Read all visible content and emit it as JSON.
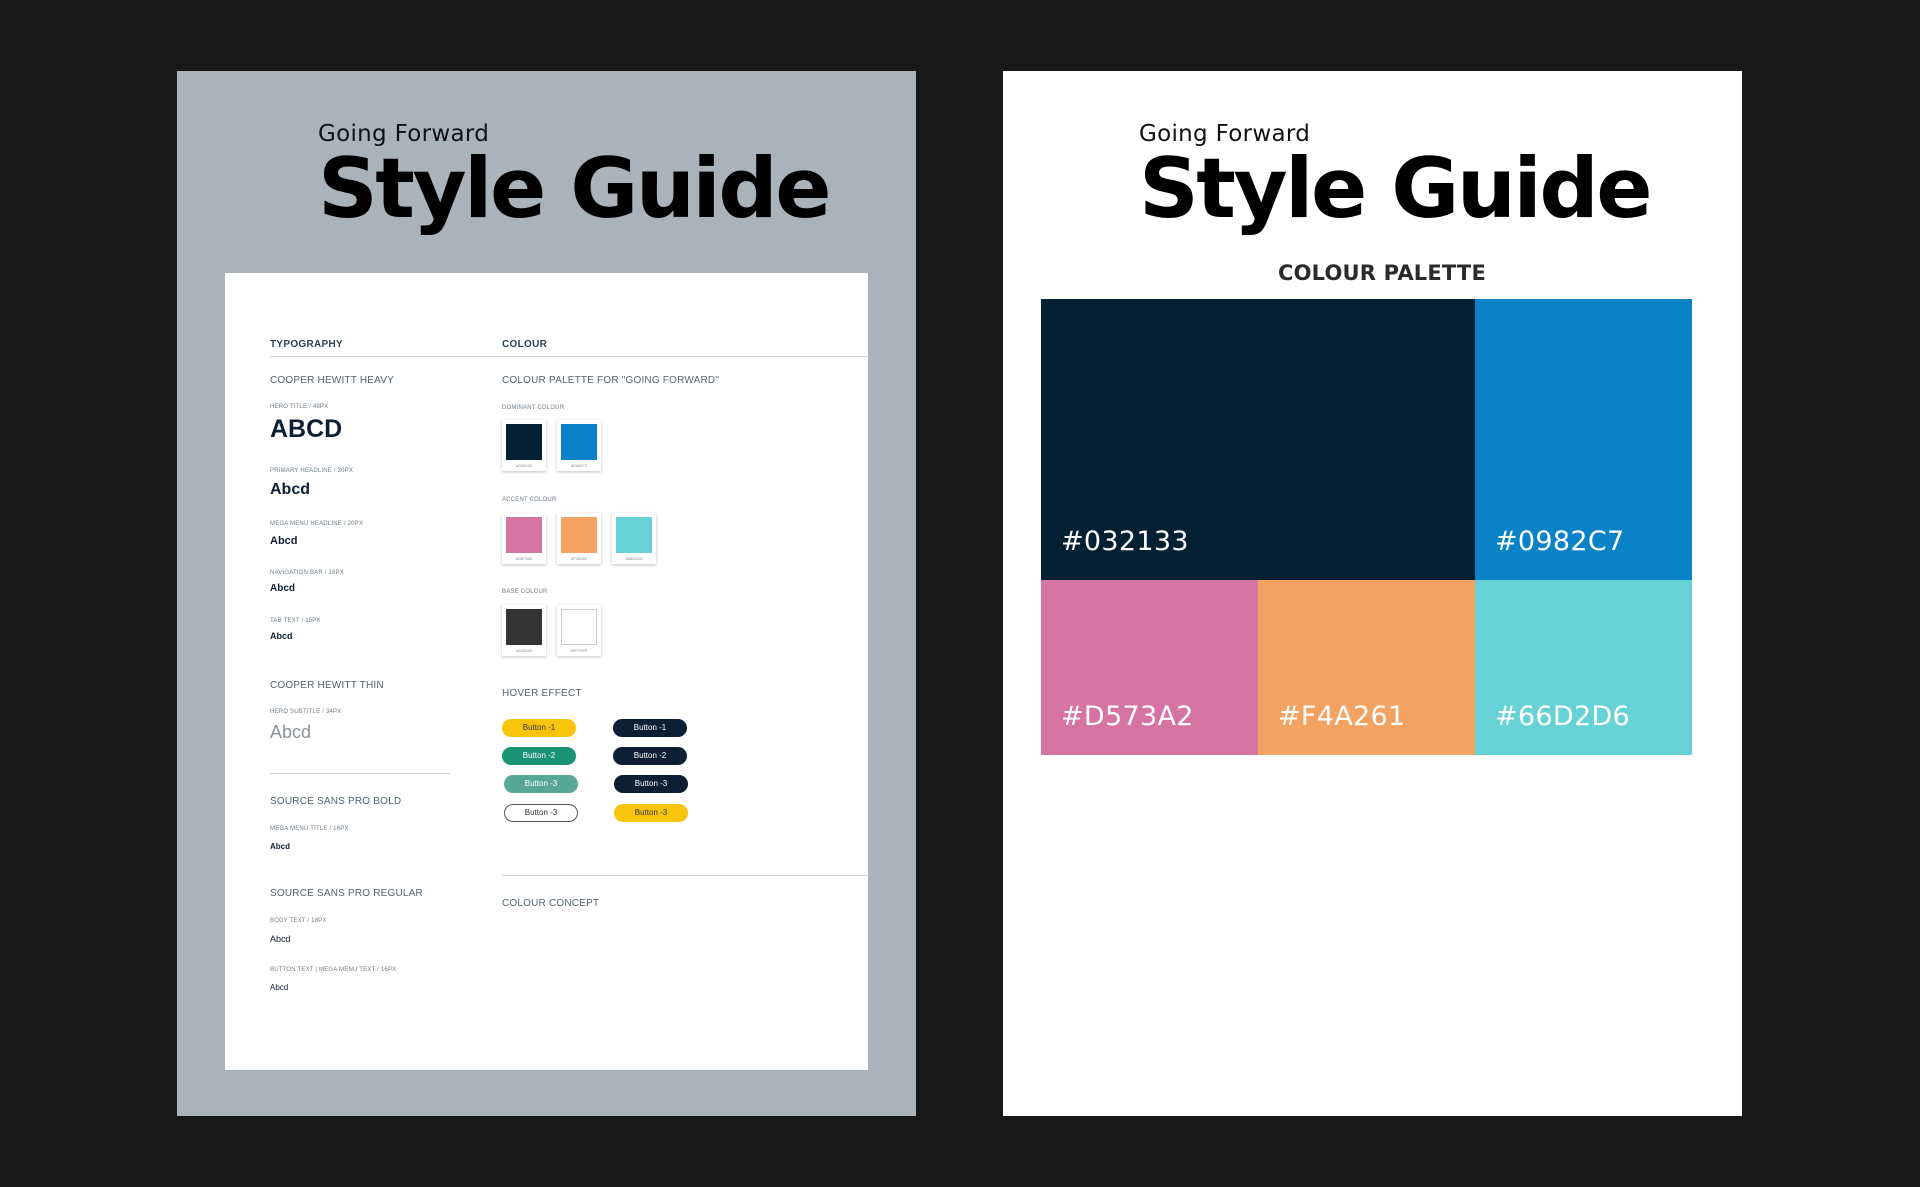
{
  "left_board": {
    "subtitle": "Going Forward",
    "title": "Style Guide",
    "typography": {
      "header": "TYPOGRAPHY",
      "font1": "COOPER HEWITT HEAVY",
      "hero_title_label": "HERO TITLE / 48PX",
      "hero_title_sample": "ABCD",
      "primary_headline_label": "PRIMARY HEADLINE / 30PX",
      "primary_headline_sample": "Abcd",
      "mega_menu_headline_label": "MEGA MENU HEADLINE / 20PX",
      "mega_menu_headline_sample": "Abcd",
      "navigation_bar_label": "NAVIGATION BAR / 18PX",
      "navigation_bar_sample": "Abcd",
      "tab_text_label": "TAB TEXT / 15PX",
      "tab_text_sample": "Abcd",
      "font2": "COOPER HEWITT THIN",
      "hero_subtitle_label": "HERO SUBTITLE / 34PX",
      "hero_subtitle_sample": "Abcd",
      "font3": "SOURCE SANS PRO BOLD",
      "mega_menu_title_label": "MEGA MENU TITLE / 16PX",
      "mega_menu_title_sample": "Abcd",
      "font4": "SOURCE SANS PRO REGULAR",
      "body_text_label": "BODY TEXT / 18PX",
      "body_text_sample": "Abcd",
      "button_text_label": "BUTTON TEXT | MEGA MENU TEXT / 16PX",
      "button_text_sample": "Abcd"
    },
    "colour": {
      "header": "COLOUR",
      "palette_heading": "COLOUR PALETTE FOR \"GOING FORWARD\"",
      "dominant_label": "DOMINANT COLOUR",
      "dominant": [
        {
          "hex": "#032133",
          "color": "#032133"
        },
        {
          "hex": "#0982C7",
          "color": "#0982c7"
        }
      ],
      "accent_label": "ACCENT COLOUR",
      "accent": [
        {
          "hex": "#D573A2",
          "color": "#d573a2"
        },
        {
          "hex": "#F4A261",
          "color": "#f4a261"
        },
        {
          "hex": "#66D2D6",
          "color": "#66d2d6"
        }
      ],
      "base_label": "BASE COLOUR",
      "base": [
        {
          "hex": "#333333",
          "color": "#333333"
        },
        {
          "hex": "#FFFFFF",
          "color": "#ffffff"
        }
      ],
      "hover_label": "HOVER EFFECT",
      "buttons_left": [
        "Button -1",
        "Button -2",
        "Button -3",
        "Button -3"
      ],
      "buttons_right": [
        "Button -1",
        "Button -2",
        "Button -3",
        "Button -3"
      ],
      "concept_label": "COLOUR CONCEPT"
    }
  },
  "right_board": {
    "subtitle": "Going Forward",
    "title": "Style Guide",
    "palette_title": "COLOUR PALETTE",
    "blocks": [
      {
        "label": "#032133",
        "color": "#032133"
      },
      {
        "label": "#0982C7",
        "color": "#0982c7"
      },
      {
        "label": "#D573A2",
        "color": "#d573a2"
      },
      {
        "label": "#F4A261",
        "color": "#f4a261"
      },
      {
        "label": "#66D2D6",
        "color": "#66d2d6"
      }
    ]
  },
  "colors": {
    "background": "#181818",
    "left_board_bg": "#a8b3ba",
    "yellow": "#f8c40d",
    "green": "#1a9373",
    "teal_green": "#56a895",
    "navy": "#0d1f33"
  }
}
